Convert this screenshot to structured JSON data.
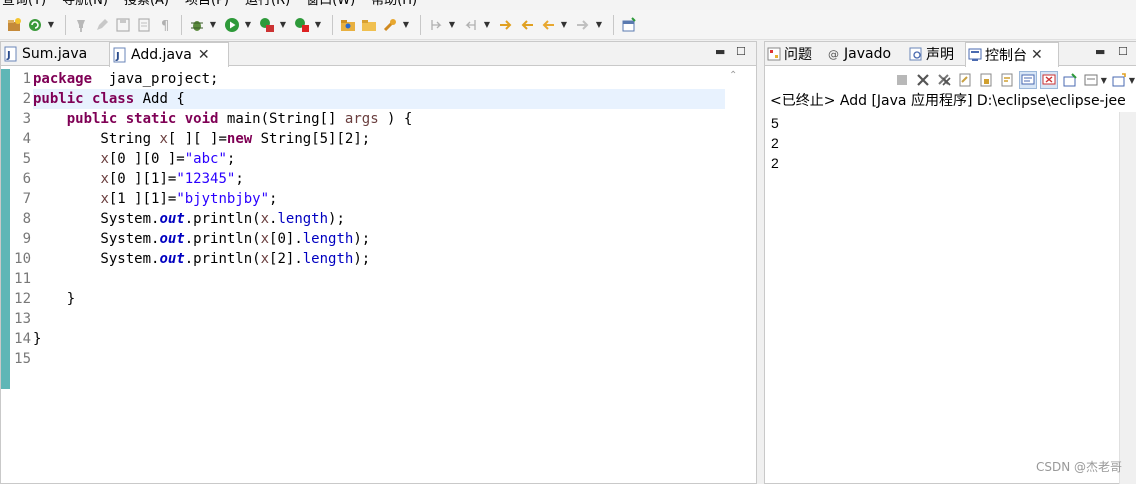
{
  "menubar": {
    "items": [
      "查询(Y)",
      "导航(N)",
      "搜索(A)",
      "项目(P)",
      "运行(R)",
      "窗口(W)",
      "帮助(H)"
    ]
  },
  "toolbar": {
    "icons": [
      "new-package-icon",
      "refresh-icon",
      "pin-icon",
      "pen-icon",
      "save-icon",
      "page-icon",
      "pilcrow-icon",
      "debug-icon",
      "run-icon",
      "run-config-icon",
      "coverage-icon",
      "open-type-icon",
      "open-folder-icon",
      "wrench-icon",
      "next-annotation-icon",
      "prev-annotation-icon",
      "forward-icon",
      "back-icon",
      "back-history-icon",
      "forward-history-icon",
      "new-window-icon"
    ]
  },
  "editor": {
    "tabs": [
      {
        "label": "Sum.java",
        "active": false
      },
      {
        "label": "Add.java",
        "active": true
      }
    ],
    "line_numbers": [
      "1",
      "2",
      "3",
      "4",
      "5",
      "6",
      "7",
      "8",
      "9",
      "10",
      "11",
      "12",
      "13",
      "14",
      "15"
    ],
    "current_line": 2
  },
  "console": {
    "tabs": [
      {
        "label": "问题",
        "icon": "problems-icon"
      },
      {
        "label": "Javado",
        "icon": "at-icon"
      },
      {
        "label": "声明",
        "icon": "declaration-icon"
      },
      {
        "label": "控制台",
        "icon": "console-icon",
        "active": true
      }
    ],
    "terminated_line": "<已终止> Add [Java 应用程序] D:\\eclipse\\eclipse-jee",
    "output": [
      "5",
      "2",
      "2"
    ]
  },
  "watermark": "CSDN @杰老哥",
  "colors": {
    "keyword": "#7f0055",
    "string": "#2a00ff",
    "field": "#0000c0",
    "gutter": "#5fb6b6",
    "current_line": "#e8f2fe"
  }
}
